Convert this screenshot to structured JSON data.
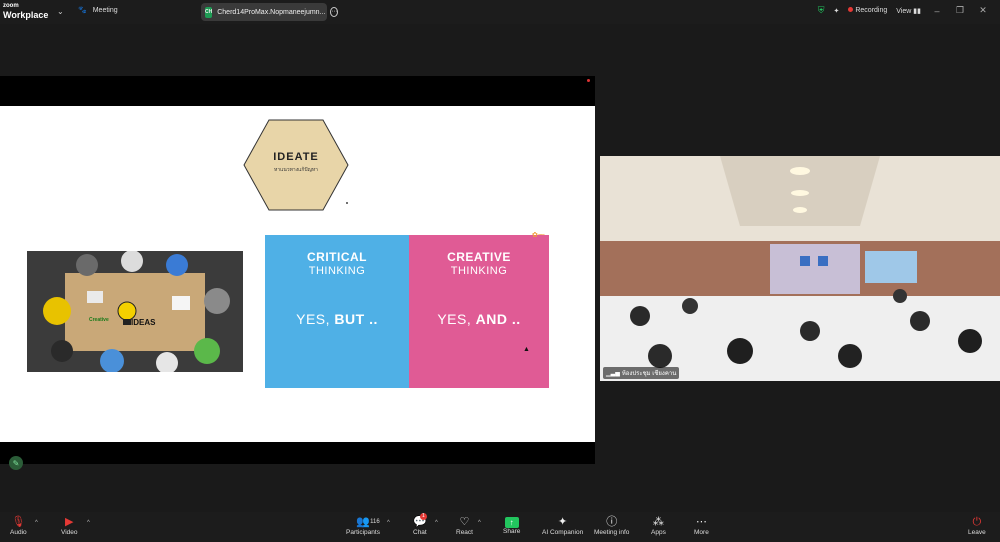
{
  "app": {
    "brand_top": "zoom",
    "brand_bottom": "Workplace",
    "meeting_label": "Meeting"
  },
  "sharing": {
    "badge": "CH",
    "name": "Cherd14ProMax.Nopmaneejumn...",
    "more": "⋯"
  },
  "top_right": {
    "recording": "Recording",
    "view": "View"
  },
  "slide": {
    "hex_title": "IDEATE",
    "hex_subtitle": "หาแนวทางแก้ปัญหา",
    "left": {
      "title": "CRITICAL",
      "subtitle": "THINKING",
      "phrase_a": "YES, ",
      "phrase_b": "BUT ..",
      "color": "#4fb0e6"
    },
    "right": {
      "title": "CREATIVE",
      "subtitle": "THINKING",
      "phrase_a": "YES, ",
      "phrase_b": "AND ..",
      "color": "#e05b95"
    },
    "photo_word": "IDEAS",
    "photo_word2": "Creative"
  },
  "video": {
    "participant_name": "ห้องประชุม เชียงคาน"
  },
  "toolbar": {
    "audio": "Audio",
    "video": "Video",
    "participants": "Participants",
    "participants_count": "116",
    "chat": "Chat",
    "chat_badge": "1",
    "react": "React",
    "share": "Share",
    "ai": "AI Companion",
    "info": "Meeting info",
    "apps": "Apps",
    "more": "More",
    "leave": "Leave"
  },
  "colors": {
    "accent_green": "#22c55e",
    "record_red": "#e53935",
    "hex_fill": "#e8d5a8"
  }
}
